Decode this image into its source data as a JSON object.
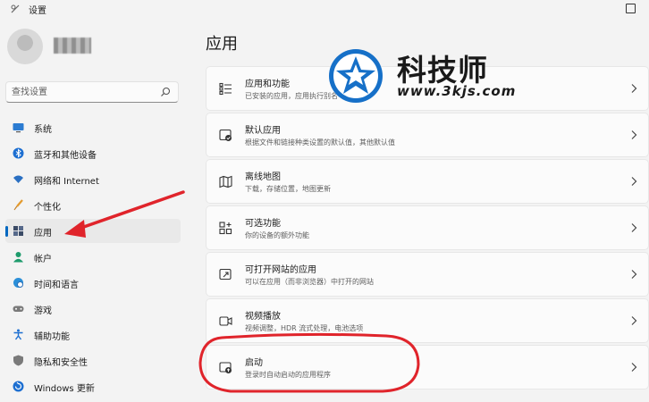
{
  "window": {
    "title": "设置"
  },
  "search": {
    "placeholder": "查找设置"
  },
  "sidebar": {
    "items": [
      {
        "label": "系统",
        "icon": "monitor-icon"
      },
      {
        "label": "蓝牙和其他设备",
        "icon": "bluetooth-icon"
      },
      {
        "label": "网络和 Internet",
        "icon": "wifi-icon"
      },
      {
        "label": "个性化",
        "icon": "brush-icon"
      },
      {
        "label": "应用",
        "icon": "apps-icon",
        "selected": true
      },
      {
        "label": "帐户",
        "icon": "person-icon"
      },
      {
        "label": "时间和语言",
        "icon": "globe-clock-icon"
      },
      {
        "label": "游戏",
        "icon": "gamepad-icon"
      },
      {
        "label": "辅助功能",
        "icon": "accessibility-icon"
      },
      {
        "label": "隐私和安全性",
        "icon": "shield-icon"
      },
      {
        "label": "Windows 更新",
        "icon": "update-icon"
      }
    ]
  },
  "main": {
    "title": "应用",
    "cards": [
      {
        "title": "应用和功能",
        "subtitle": "已安装的应用，应用执行别名",
        "icon": "list-icon"
      },
      {
        "title": "默认应用",
        "subtitle": "根据文件和链接种类设置的默认值，其他默认值",
        "icon": "default-app-icon"
      },
      {
        "title": "离线地图",
        "subtitle": "下载，存储位置，地图更新",
        "icon": "map-icon"
      },
      {
        "title": "可选功能",
        "subtitle": "你的设备的额外功能",
        "icon": "add-apps-icon"
      },
      {
        "title": "可打开网站的应用",
        "subtitle": "可以在应用（而非浏览器）中打开的网站",
        "icon": "open-in-app-icon"
      },
      {
        "title": "视频播放",
        "subtitle": "视频调整，HDR 流式处理，电池选项",
        "icon": "video-icon"
      },
      {
        "title": "启动",
        "subtitle": "登录时自动启动的应用程序",
        "icon": "startup-icon"
      }
    ]
  },
  "watermark": {
    "brand": "科技师",
    "url": "www.3kjs.com"
  },
  "colors": {
    "accent": "#0067c0",
    "annotation": "#e0242b",
    "watermark_blue": "#1670c8"
  }
}
